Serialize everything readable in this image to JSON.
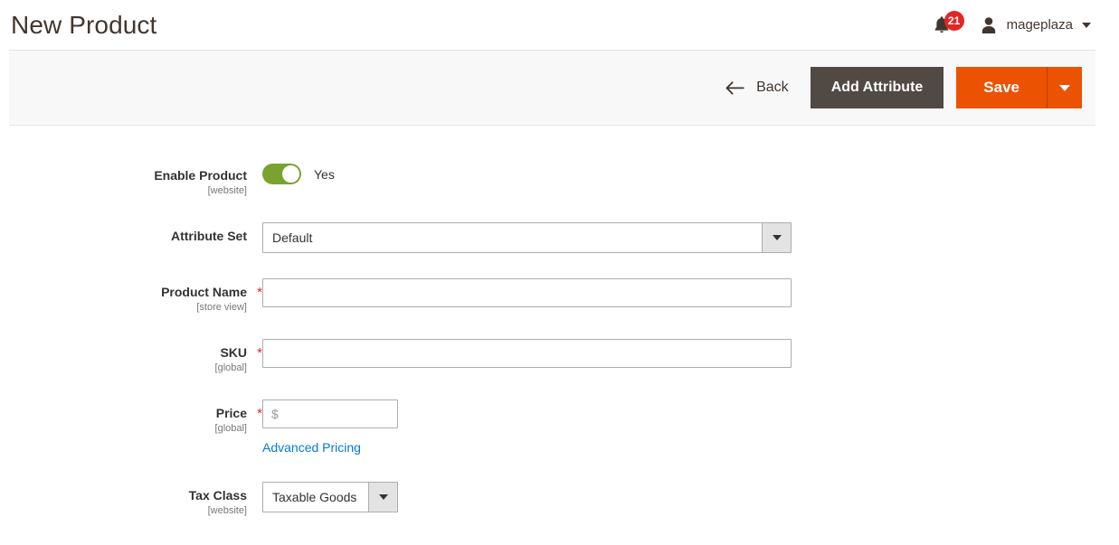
{
  "header": {
    "title": "New Product",
    "notifications": {
      "icon": "bell-icon",
      "count": "21"
    },
    "user": {
      "icon": "avatar-icon",
      "name": "mageplaza",
      "caret": "chevron-down-icon"
    }
  },
  "toolbar": {
    "back_label": "Back",
    "back_icon": "arrow-left-icon",
    "add_attribute_label": "Add Attribute",
    "save_label": "Save",
    "save_toggle_icon": "chevron-down-icon"
  },
  "form": {
    "enable_product": {
      "label": "Enable Product",
      "scope": "[website]",
      "value": "Yes",
      "toggle_on": true
    },
    "attribute_set": {
      "label": "Attribute Set",
      "value": "Default"
    },
    "product_name": {
      "label": "Product Name",
      "scope": "[store view]",
      "required": "*",
      "value": "",
      "placeholder": ""
    },
    "sku": {
      "label": "SKU",
      "scope": "[global]",
      "required": "*",
      "value": "",
      "placeholder": ""
    },
    "price": {
      "label": "Price",
      "scope": "[global]",
      "required": "*",
      "value": "",
      "placeholder": "$",
      "advanced_pricing_label": "Advanced Pricing"
    },
    "tax_class": {
      "label": "Tax Class",
      "scope": "[website]",
      "value": "Taxable Goods"
    }
  },
  "colors": {
    "accent_orange": "#eb5202",
    "dark_button": "#514943",
    "toggle_green": "#79a22e",
    "link_blue": "#007bdb",
    "badge_red": "#e22626"
  }
}
